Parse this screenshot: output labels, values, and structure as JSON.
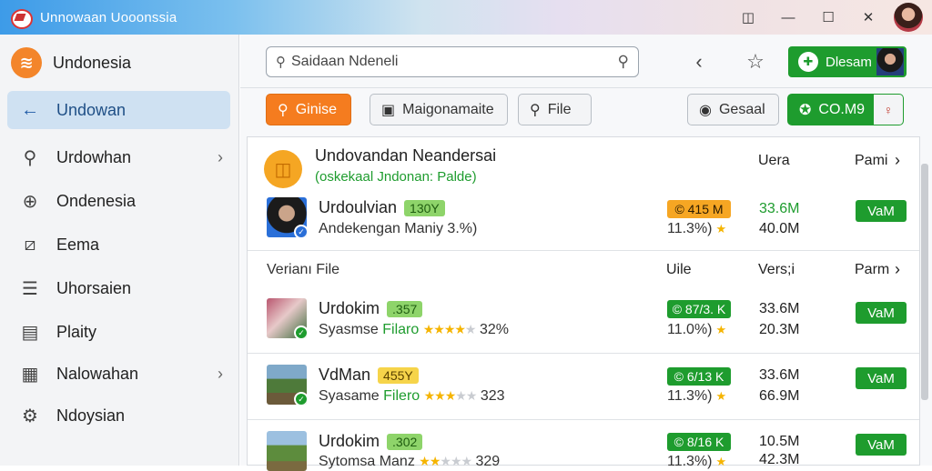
{
  "window": {
    "title": "Unnowaan Uooonssia",
    "app_icon": "app-logo-icon"
  },
  "titlebar": {
    "icons": [
      "camera-icon",
      "minimize-icon",
      "maximize-icon",
      "avatar"
    ]
  },
  "sidebar": {
    "items": [
      {
        "label": "Undonesia",
        "icon": "brand-icon",
        "chevron": false
      },
      {
        "label": "Undowan",
        "icon": "arrow-left-icon",
        "chevron": false,
        "active": true
      },
      {
        "label": "Urdowhan",
        "icon": "search-icon",
        "chevron": true
      },
      {
        "label": "Ondenesia",
        "icon": "plus-circle-icon",
        "chevron": false
      },
      {
        "label": "Eema",
        "icon": "crop-icon",
        "chevron": false
      },
      {
        "label": "Uhorsaien",
        "icon": "document-icon",
        "chevron": false
      },
      {
        "label": "Plaity",
        "icon": "list-icon",
        "chevron": false
      },
      {
        "label": "Nalowahan",
        "icon": "calendar-icon",
        "chevron": true
      },
      {
        "label": "Ndoysian",
        "icon": "gear-icon",
        "chevron": false
      }
    ]
  },
  "header": {
    "search_value": "Saidaan Ndeneli",
    "download_label": "Dlesam"
  },
  "toolbar": {
    "buttons": [
      {
        "label": "Ginise",
        "icon": "search-icon",
        "style": "orange"
      },
      {
        "label": "Maigonamaite",
        "icon": "gallery-icon",
        "style": "default"
      },
      {
        "label": "File",
        "icon": "search-icon",
        "style": "default"
      },
      {
        "label": "Gesaal",
        "icon": "circle-icon",
        "style": "default"
      },
      {
        "label": "CO.M9",
        "icon": "star-icon",
        "style": "green"
      }
    ]
  },
  "list": {
    "selected": {
      "title": "Undovandan Neandersai",
      "subtitle": "(oskekaal Jndonan: Palde)",
      "col1": "Uera",
      "col2": "Pami",
      "chevron": "›"
    },
    "featured_row": {
      "name": "Urdoulvian",
      "tag": "130Y",
      "sub": "Andekengan Maniy 3.%)",
      "pill": "© 415 M",
      "rating": "11.3%)",
      "num1": "33.6M",
      "num2": "40.0M",
      "button": "VaM"
    },
    "section_header": {
      "title": "Verianı File",
      "col1": "Uile",
      "col2": "Vers;i",
      "col3": "Parm",
      "chevron": "›"
    },
    "rows": [
      {
        "name": "Urdokim",
        "tag": ".357",
        "sub": "Syasmse",
        "sub_green": "Filaro",
        "stars": 4,
        "pct": "32%",
        "pill": "© 87/3. K",
        "rating": "11.0%)",
        "num1": "33.6M",
        "num2": "20.3M",
        "button": "VaM"
      },
      {
        "name": "VdMan",
        "tag": "455Y",
        "sub": "Syasame",
        "sub_green": "Filero",
        "stars": 3,
        "pct": "323",
        "pill": "© 6/13 K",
        "rating": "11.3%)",
        "num1": "33.6M",
        "num2": "66.9M",
        "button": "VaM"
      },
      {
        "name": "Urdokim",
        "tag": ".302",
        "sub": "Sytomsa",
        "sub_green": "Manz",
        "stars": 2,
        "pct": "329",
        "pill": "© 8/16 K",
        "rating": "11.3%)",
        "num1": "10.5M",
        "num2": "42.3M",
        "button": "VaM"
      }
    ]
  }
}
